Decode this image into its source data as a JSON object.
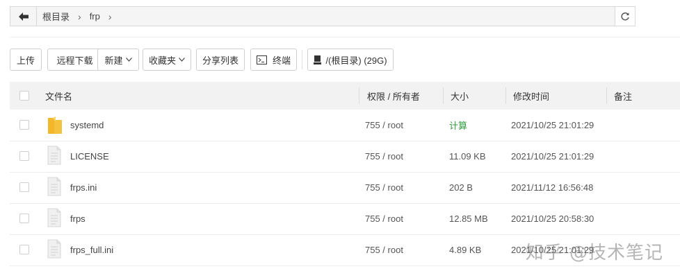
{
  "pathbar": {
    "crumbs": [
      "根目录",
      "frp"
    ]
  },
  "toolbar": {
    "upload": "上传",
    "remote_download": "远程下载",
    "new": "新建",
    "favorites": "收藏夹",
    "share_list": "分享列表",
    "terminal": "终端",
    "disk": "/(根目录) (29G)"
  },
  "table": {
    "headers": {
      "name": "文件名",
      "perm": "权限 / 所有者",
      "size": "大小",
      "mtime": "修改时间",
      "note": "备注"
    },
    "rows": [
      {
        "name": "systemd",
        "type": "folder",
        "perm": "755 / root",
        "size": "计算",
        "mtime": "2021/10/25 21:01:29"
      },
      {
        "name": "LICENSE",
        "type": "file",
        "perm": "755 / root",
        "size": "11.09 KB",
        "mtime": "2021/10/25 21:01:29"
      },
      {
        "name": "frps.ini",
        "type": "file",
        "perm": "755 / root",
        "size": "202 B",
        "mtime": "2021/11/12 16:56:48"
      },
      {
        "name": "frps",
        "type": "file",
        "perm": "755 / root",
        "size": "12.85 MB",
        "mtime": "2021/10/25 20:58:30"
      },
      {
        "name": "frps_full.ini",
        "type": "file",
        "perm": "755 / root",
        "size": "4.89 KB",
        "mtime": "2021/10/25 21:01:29"
      }
    ]
  },
  "watermark": "知乎 @技术笔记",
  "colors": {
    "folder": "#f5c23f",
    "calc_link": "#2e9c3a",
    "header_bg": "#f2f2f2"
  }
}
